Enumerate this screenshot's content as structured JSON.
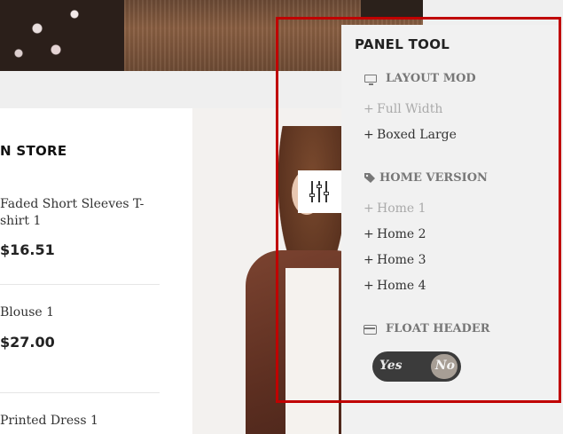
{
  "store": {
    "title": "N STORE",
    "products": [
      {
        "name": "Faded Short Sleeves T-shirt 1",
        "price": "$16.51"
      },
      {
        "name": "Blouse 1",
        "price": "$27.00"
      },
      {
        "name": "Printed Dress 1"
      }
    ]
  },
  "panel": {
    "title": "PANEL TOOL",
    "layout_mode": {
      "heading": "LAYOUT MOD",
      "icon": "monitor-icon",
      "options": [
        "Full Width",
        "Boxed Large"
      ],
      "active": "Full Width"
    },
    "home_version": {
      "heading": "HOME VERSION",
      "icon": "tag-icon",
      "options": [
        "Home 1",
        "Home 2",
        "Home 3",
        "Home 4"
      ],
      "active": "Home 1"
    },
    "float_header": {
      "heading": "FLOAT HEADER",
      "icon": "credit-card-icon",
      "yes_label": "Yes",
      "no_label": "No",
      "selected": "No"
    },
    "plus": "+"
  },
  "colors": {
    "highlight": "#c00000",
    "panel_bg": "#f1f1f1",
    "active_option": "#aaaaaa",
    "toggle_bg": "#3b3b3b",
    "toggle_knob": "#a79e95"
  }
}
